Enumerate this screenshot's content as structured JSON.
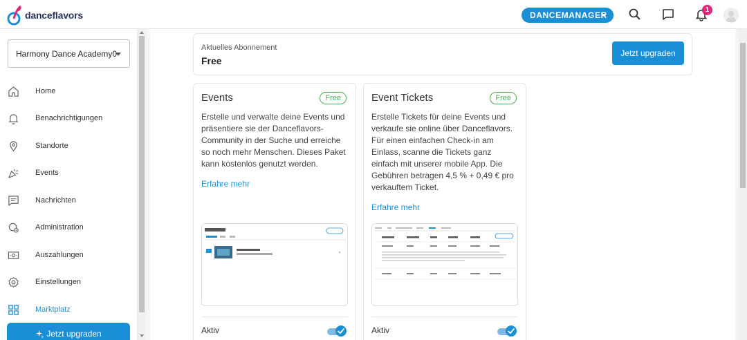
{
  "header": {
    "logo_text": "danceflavors",
    "role_button": "DANCEMANAGER",
    "notification_count": "1"
  },
  "sidebar": {
    "studio": "Harmony Dance Academy0",
    "items": [
      {
        "label": "Home",
        "icon": "home-icon"
      },
      {
        "label": "Benachrichtigungen",
        "icon": "bell-icon"
      },
      {
        "label": "Standorte",
        "icon": "location-icon"
      },
      {
        "label": "Events",
        "icon": "party-icon"
      },
      {
        "label": "Nachrichten",
        "icon": "message-icon"
      },
      {
        "label": "Administration",
        "icon": "admin-icon"
      },
      {
        "label": "Auszahlungen",
        "icon": "payout-icon"
      },
      {
        "label": "Einstellungen",
        "icon": "settings-icon"
      },
      {
        "label": "Marktplatz",
        "icon": "grid-icon",
        "active": true
      }
    ],
    "upgrade_label": "Jetzt upgraden"
  },
  "subscription": {
    "label": "Aktuelles Abonnement",
    "value": "Free",
    "button": "Jetzt upgraden"
  },
  "packages": [
    {
      "title": "Events",
      "badge": "Free",
      "description": "Erstelle und verwalte deine Events und präsentiere sie der Danceflavors-Community in der Suche und erreiche so noch mehr Menschen. Dieses Paket kann kostenlos genutzt werden.",
      "link": "Erfahre mehr",
      "active_label": "Aktiv",
      "active": true
    },
    {
      "title": "Event Tickets",
      "badge": "Free",
      "description": "Erstelle Tickets für deine Events und verkaufe sie online über Danceflavors. Für einen einfachen Check-in am Einlass, scanne die Tickets ganz einfach mit unserer mobile App. Die Gebühren betragen 4,5 % + 0,49 € pro verkauftem Ticket.",
      "link": "Erfahre mehr",
      "active_label": "Aktiv",
      "active": true
    }
  ],
  "colors": {
    "accent": "#1a8fd6",
    "badge_green": "#4caf50",
    "notification": "#e0267b"
  }
}
